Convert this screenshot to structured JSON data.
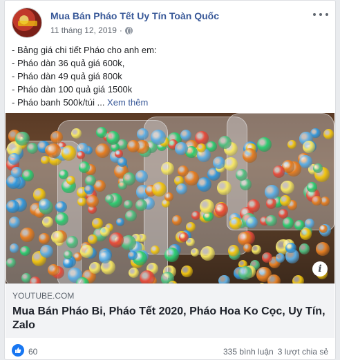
{
  "post": {
    "page_name": "Mua Bán Pháo Tết Uy Tín Toàn Quốc",
    "timestamp": "11 tháng 12, 2019",
    "text_lines": [
      "- Bảng giá chi tiết Pháo cho anh em:",
      "- Pháo dàn 36 quả giá 600k,",
      "- Pháo dàn 49 quả giá 800k",
      "- Pháo dàn 100 quả giá 1500k",
      "- Pháo banh 500k/túi ... "
    ],
    "see_more": "Xem thêm"
  },
  "link_preview": {
    "domain": "YOUTUBE.COM",
    "title": "Mua Bán Pháo Bi, Pháo Tết 2020, Pháo Hoa Ko Cọc, Uy Tín, Zalo"
  },
  "footer": {
    "likes": "60",
    "comments": "335 bình luận",
    "shares": "3 lượt chia sẻ"
  },
  "colors": {
    "accent": "#385898",
    "like_blue": "#1877f2"
  },
  "icons": [
    "avatar",
    "globe-icon",
    "more-icon",
    "info-icon",
    "like-icon"
  ]
}
